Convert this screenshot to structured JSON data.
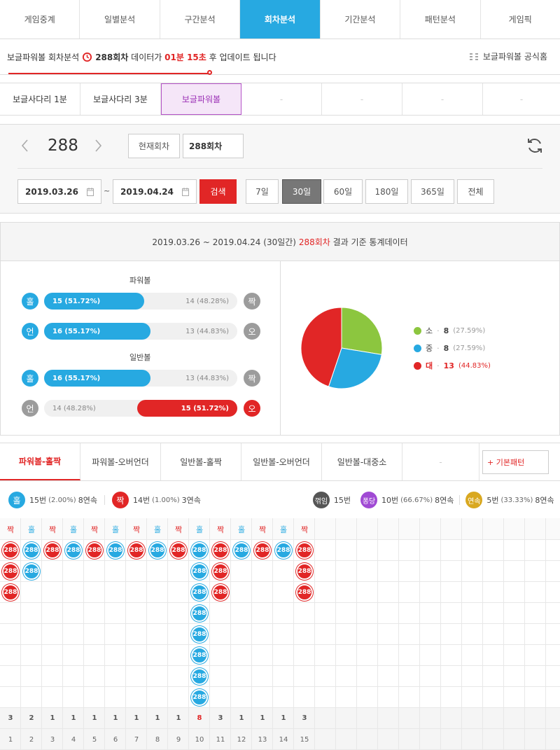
{
  "topnav": [
    "게임중계",
    "일별분석",
    "구간분석",
    "회차분석",
    "기간분석",
    "패턴분석",
    "게임픽"
  ],
  "info": {
    "prefix": "보글파워볼 회차분석",
    "round": "288회차",
    "mid": "데이터가",
    "time": "01분 15초",
    "suffix": "후 업데이트 됩니다",
    "home": "보글파워볼 공식홈"
  },
  "subtabs": [
    "보글사다리 1분",
    "보글사다리 3분",
    "보글파워볼",
    "-",
    "-",
    "-",
    "-"
  ],
  "control": {
    "round": "288",
    "current_btn": "현재회차",
    "round_field": "288회차",
    "date_from": "2019.03.26",
    "tilde": "~",
    "date_to": "2019.04.24",
    "search": "검색",
    "ranges": [
      "7일",
      "30일",
      "60일",
      "180일",
      "365일",
      "전체"
    ]
  },
  "stats": {
    "range": "2019.03.26 ~ 2019.04.24 (30일간)",
    "round": "288회차",
    "suffix": "결과 기준 통계데이터",
    "power_label": "파워볼",
    "normal_label": "일반볼",
    "rows": [
      {
        "l": "홀",
        "r": "짝",
        "lv": "15 (51.72%)",
        "rv": "14 (48.28%)",
        "winner": "left",
        "pct": 51.72
      },
      {
        "l": "언",
        "r": "오",
        "lv": "16 (55.17%)",
        "rv": "13 (44.83%)",
        "winner": "left",
        "pct": 55.17
      },
      {
        "l": "홀",
        "r": "짝",
        "lv": "16 (55.17%)",
        "rv": "13 (44.83%)",
        "winner": "left",
        "pct": 55.17
      },
      {
        "l": "언",
        "r": "오",
        "lv": "14 (48.28%)",
        "rv": "15 (51.72%)",
        "winner": "right",
        "pct": 51.72
      }
    ],
    "legend": [
      {
        "name": "소",
        "count": "8",
        "pct": "(27.59%)",
        "color": "#8cc63f"
      },
      {
        "name": "중",
        "count": "8",
        "pct": "(27.59%)",
        "color": "#27a9e1"
      },
      {
        "name": "대",
        "count": "13",
        "pct": "(44.83%)",
        "color": "#e12626"
      }
    ]
  },
  "ptabs": [
    "파워볼-홀짝",
    "파워볼-오버언더",
    "일반볼-홀짝",
    "일반볼-오버언더",
    "일반볼-대중소",
    "-",
    "+ 기본패턴"
  ],
  "summary": {
    "odd_label": "홀",
    "odd_text": "15번",
    "odd_pct": "(2.00%)",
    "odd_streak": "8연속",
    "even_label": "짝",
    "even_text": "14번",
    "even_pct": "(1.00%)",
    "even_streak": "3연속",
    "k1": "꺾임",
    "k1v": "15번",
    "k2": "퐁당",
    "k2v": "10번",
    "k2p": "(66.67%)",
    "k2s": "8연속",
    "k3": "연속",
    "k3v": "5번",
    "k3p": "(33.33%)",
    "k3s": "8연속"
  },
  "grid": {
    "ball_label": "288",
    "columns": [
      {
        "h": "짝",
        "n": 3
      },
      {
        "h": "홀",
        "n": 2
      },
      {
        "h": "짝",
        "n": 1
      },
      {
        "h": "홀",
        "n": 1
      },
      {
        "h": "짝",
        "n": 1
      },
      {
        "h": "홀",
        "n": 1
      },
      {
        "h": "짝",
        "n": 1
      },
      {
        "h": "홀",
        "n": 1
      },
      {
        "h": "짝",
        "n": 1
      },
      {
        "h": "홀",
        "n": 8
      },
      {
        "h": "짝",
        "n": 3
      },
      {
        "h": "홀",
        "n": 1
      },
      {
        "h": "짝",
        "n": 1
      },
      {
        "h": "홀",
        "n": 1
      },
      {
        "h": "짝",
        "n": 3
      }
    ],
    "counts": [
      "3",
      "2",
      "1",
      "1",
      "1",
      "1",
      "1",
      "1",
      "1",
      "8",
      "3",
      "1",
      "1",
      "1",
      "3"
    ],
    "indices": [
      "1",
      "2",
      "3",
      "4",
      "5",
      "6",
      "7",
      "8",
      "9",
      "10",
      "11",
      "12",
      "13",
      "14",
      "15"
    ]
  }
}
